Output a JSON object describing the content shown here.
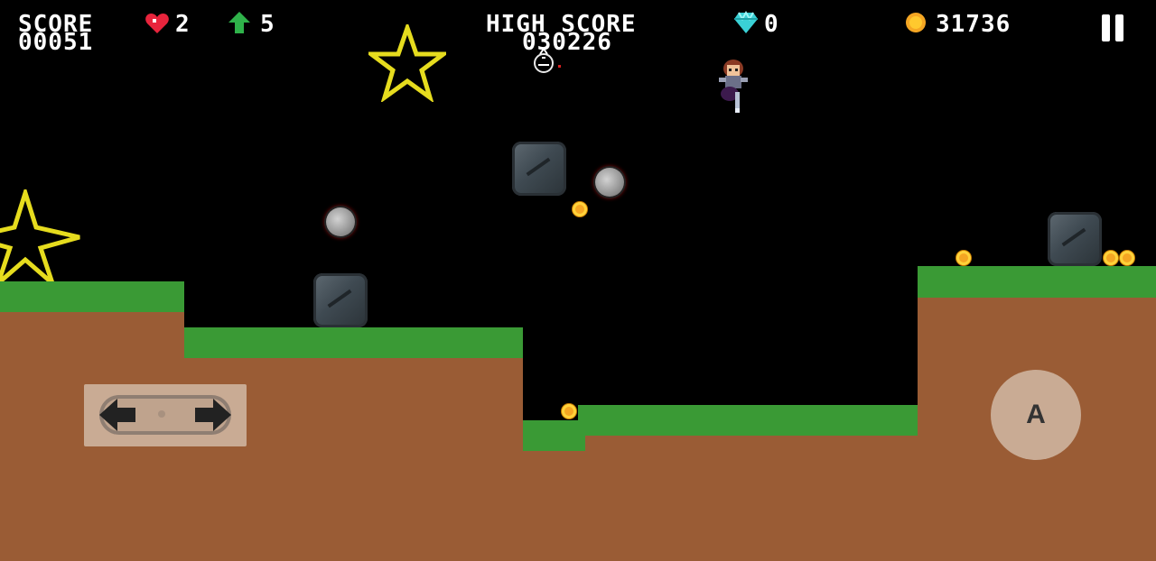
{
  "hud": {
    "score_label": "SCORE",
    "score_value": "00051",
    "lives": "2",
    "powerups": "5",
    "high_score_label": "HIGH SCORE",
    "high_score_value": "030226",
    "gems": "0",
    "coins": "31736"
  },
  "controls": {
    "action_button_label": "A"
  },
  "icons": {
    "lives": "heart-icon",
    "powerups": "green-arrow-up-icon",
    "gems": "diamond-icon",
    "coins": "coin-icon",
    "pause": "pause-icon"
  },
  "colors": {
    "background": "#000000",
    "grass": "#3a9a35",
    "dirt": "#9a5c35",
    "star_outline": "#e6dc1e",
    "coin": "#f5a623",
    "control_bg": "#c9ab94"
  }
}
